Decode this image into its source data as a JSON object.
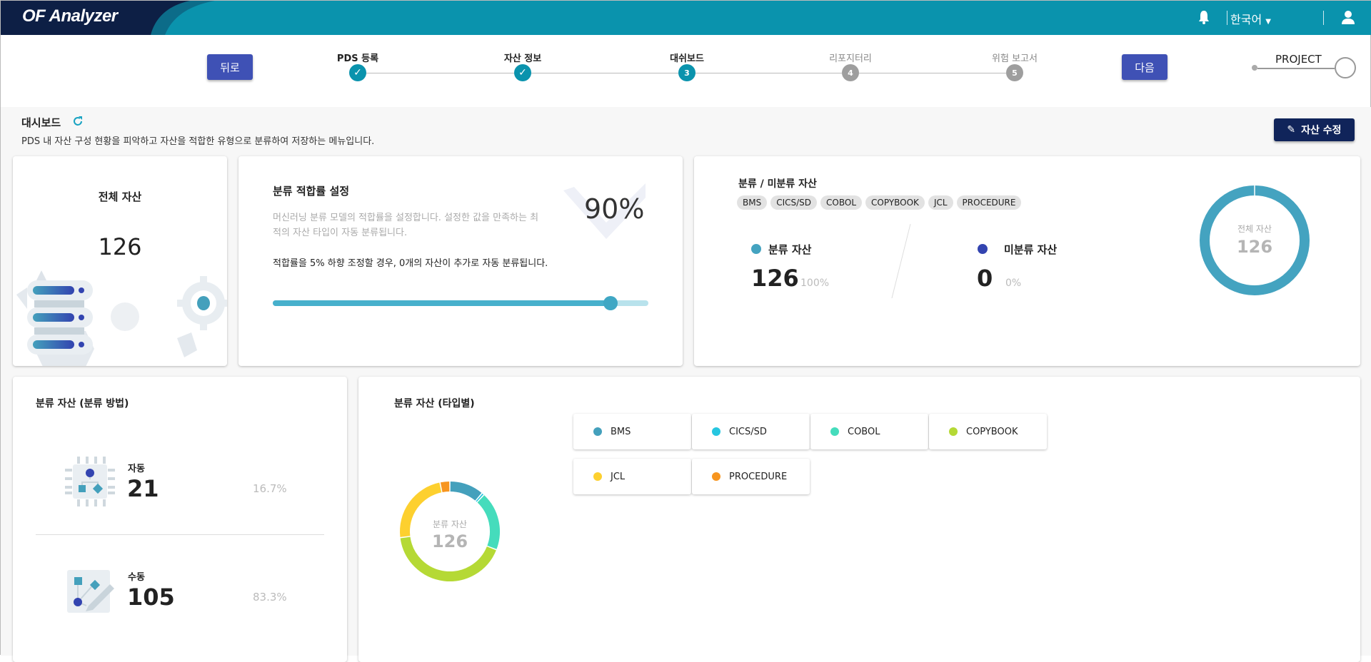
{
  "header": {
    "logo": "OF Analyzer",
    "language": "한국어",
    "icons": [
      "bell-icon",
      "user-icon"
    ]
  },
  "stepper": {
    "back": "뒤로",
    "next": "다음",
    "project": "PROJECT",
    "steps": [
      {
        "label": "PDS 등록",
        "state": "done"
      },
      {
        "label": "자산 정보",
        "state": "done"
      },
      {
        "label": "대쉬보드",
        "num": "3",
        "state": "active"
      },
      {
        "label": "리포지터리",
        "num": "4",
        "state": "pending"
      },
      {
        "label": "위험 보고서",
        "num": "5",
        "state": "pending"
      }
    ]
  },
  "page": {
    "title": "대시보드",
    "subtitle": "PDS 내 자산 구성 현황을 피악하고 자산을 적합한 유형으로 분류하여 저장하는 메뉴입니다.",
    "edit_button": "자산 수정"
  },
  "total": {
    "title": "전체 자산",
    "value": "126"
  },
  "fit": {
    "title": "분류 적합률 설정",
    "desc1": "머신러닝 분류 모델의 적합률을 설정합니다. 설정한 값을 만족하는 최",
    "desc2": "적의 자산 타입이 자동 분류됩니다.",
    "note": "적합률을 5% 하향 조정할 경우, 0개의 자산이 추가로 자동 분류됩니다.",
    "value": "90%",
    "slider_percent": 90
  },
  "classify": {
    "title": "분류 / 미분류 자산",
    "chips": [
      "BMS",
      "CICS/SD",
      "COBOL",
      "COPYBOOK",
      "JCL",
      "PROCEDURE"
    ],
    "classified": {
      "label": "분류 자산",
      "value": "126",
      "pct": "100%",
      "color": "#44a3c0"
    },
    "unclassified": {
      "label": "미분류 자산",
      "value": "0",
      "pct": "0%",
      "color": "#3344b0"
    },
    "donut": {
      "label": "전체 자산",
      "value": "126"
    }
  },
  "method": {
    "title": "분류 자산 (분류 방법)",
    "auto": {
      "label": "자동",
      "value": "21",
      "pct": "16.7%"
    },
    "manual": {
      "label": "수동",
      "value": "105",
      "pct": "83.3%"
    }
  },
  "chart_data": {
    "type": "pie",
    "title": "분류 자산 (타입별)",
    "center_label": "분류 자산",
    "center_value": "126",
    "categories": [
      "BMS",
      "CICS/SD",
      "COBOL",
      "COPYBOOK",
      "JCL",
      "PROCEDURE"
    ],
    "values": [
      14,
      1,
      24,
      53,
      30,
      4
    ],
    "colors": [
      "#44a0bc",
      "#26c6e0",
      "#45dcbc",
      "#b5d935",
      "#fdd02f",
      "#f7951f"
    ],
    "legend": "right"
  }
}
